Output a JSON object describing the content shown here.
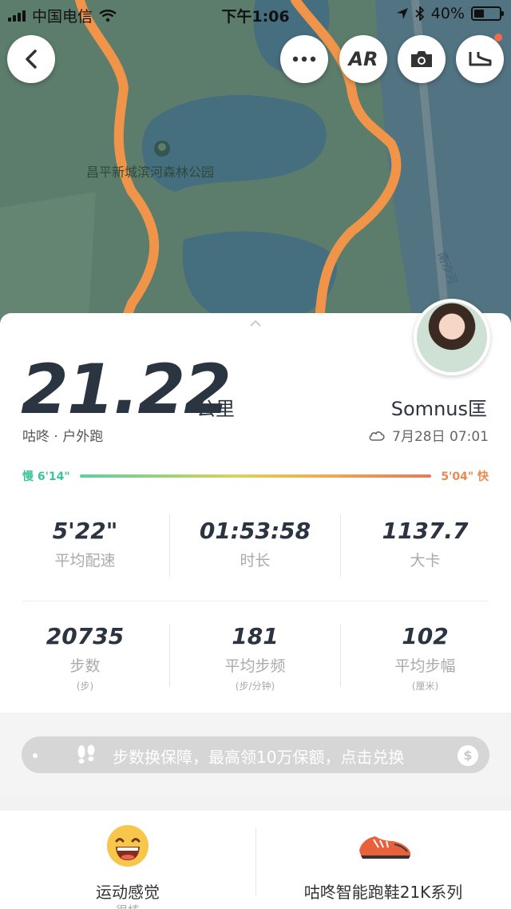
{
  "status_bar": {
    "carrier": "中国电信",
    "time": "下午1:06",
    "battery": "40%",
    "battery_level": 0.4
  },
  "map": {
    "poi_label": "昌平新城滨河森林公园",
    "road_label": "南沙河"
  },
  "map_buttons": {
    "ar_label": "AR"
  },
  "summary": {
    "distance": "21.22",
    "distance_unit": "公里",
    "activity": "咕咚 · 户外跑",
    "username": "Somnus匡",
    "datetime": "7月28日 07:01"
  },
  "pace_range": {
    "slow_label": "慢 6'14\"",
    "fast_label": "5'04\" 快"
  },
  "stats": [
    {
      "value": "5'22\"",
      "label": "平均配速",
      "unit": ""
    },
    {
      "value": "01:53:58",
      "label": "时长",
      "unit": ""
    },
    {
      "value": "1137.7",
      "label": "大卡",
      "unit": ""
    },
    {
      "value": "20735",
      "label": "步数",
      "unit": "(步)"
    },
    {
      "value": "181",
      "label": "平均步频",
      "unit": "(步/分钟)"
    },
    {
      "value": "102",
      "label": "平均步幅",
      "unit": "(厘米)"
    }
  ],
  "promo": {
    "text": "步数换保障，最高领10万保额，点击兑换",
    "coin_symbol": "$"
  },
  "bottom_cards": [
    {
      "title": "运动感觉",
      "subtitle": "很棒"
    },
    {
      "title": "咕咚智能跑鞋21K系列",
      "subtitle": ""
    }
  ],
  "colors": {
    "route": "#f0944a",
    "accent_green": "#3cc49a",
    "accent_orange": "#e88a50",
    "text_dark": "#2b3441"
  }
}
